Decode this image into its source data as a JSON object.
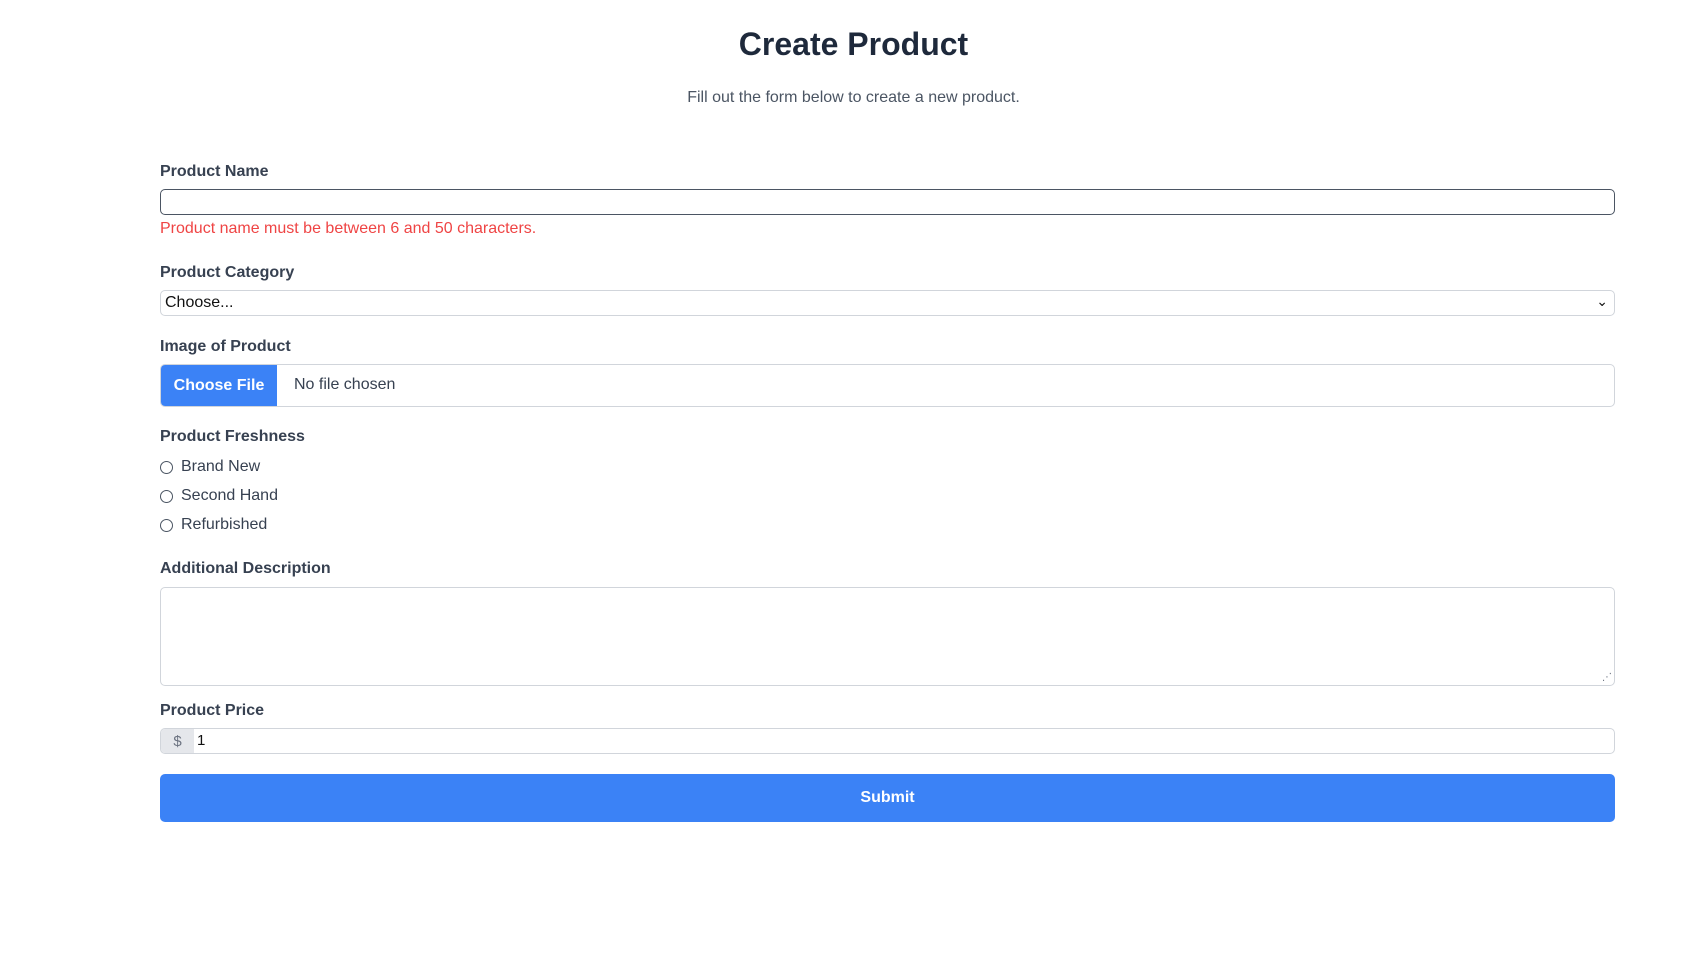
{
  "header": {
    "title": "Create Product",
    "subtitle": "Fill out the form below to create a new product."
  },
  "form": {
    "product_name": {
      "label": "Product Name",
      "value": "",
      "error": "Product name must be between 6 and 50 characters."
    },
    "category": {
      "label": "Product Category",
      "selected": "Choose..."
    },
    "image": {
      "label": "Image of Product",
      "button_label": "Choose File",
      "status": "No file chosen"
    },
    "freshness": {
      "label": "Product Freshness",
      "options": [
        "Brand New",
        "Second Hand",
        "Refurbished"
      ]
    },
    "description": {
      "label": "Additional Description",
      "value": ""
    },
    "price": {
      "label": "Product Price",
      "prefix": "$",
      "value": "1"
    },
    "submit_label": "Submit"
  },
  "colors": {
    "accent": "#3b82f6",
    "error": "#ef4444",
    "heading": "#1e293b"
  }
}
